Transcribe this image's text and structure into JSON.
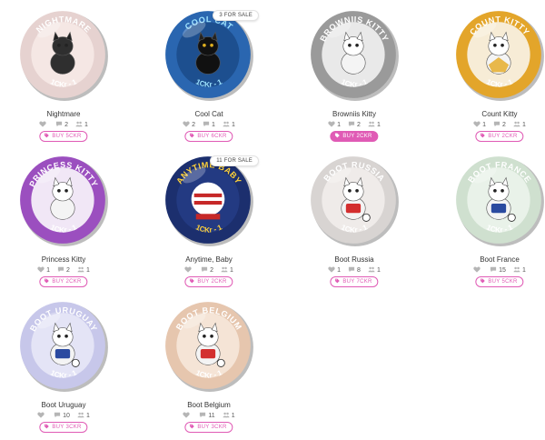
{
  "coins": [
    {
      "name": "Nightmare",
      "coin_title": "NIGHTMARE",
      "coin_sub": "1CKr - 1",
      "likes": "",
      "comments": "2",
      "owners": "1",
      "buy_label": "BUY 5CKR",
      "sale_badge": "",
      "buy_active": false,
      "rim": "#e6d2d0",
      "face": "#f5e7e4",
      "text_color": "#ffffff",
      "theme": "pink"
    },
    {
      "name": "Cool Cat",
      "coin_title": "COOL CAT",
      "coin_sub": "1CKr - 1",
      "likes": "2",
      "comments": "1",
      "owners": "1",
      "buy_label": "BUY 6CKR",
      "sale_badge": "3 FOR SALE",
      "buy_active": false,
      "rim": "#2a66b0",
      "face": "#1d4f8f",
      "text_color": "#9ee3ff",
      "theme": "blue"
    },
    {
      "name": "Browniis Kitty",
      "coin_title": "BROWNIIS KITTY",
      "coin_sub": "1CKr - 1",
      "likes": "1",
      "comments": "2",
      "owners": "1",
      "buy_label": "BUY 2CKR",
      "sale_badge": "",
      "buy_active": true,
      "rim": "#9a9a9a",
      "face": "#e9e9e9",
      "text_color": "#ffffff",
      "theme": "gray"
    },
    {
      "name": "Count Kitty",
      "coin_title": "COUNT KITTY",
      "coin_sub": "1CKr - 1",
      "likes": "1",
      "comments": "2",
      "owners": "1",
      "buy_label": "BUY 2CKR",
      "sale_badge": "",
      "buy_active": false,
      "rim": "#e3a52a",
      "face": "#f7ecd6",
      "text_color": "#ffffff",
      "theme": "gold"
    },
    {
      "name": "Princess Kitty",
      "coin_title": "PRINCESS KITTY",
      "coin_sub": "1CKr - 1",
      "likes": "1",
      "comments": "2",
      "owners": "1",
      "buy_label": "BUY 2CKR",
      "sale_badge": "",
      "buy_active": false,
      "rim": "#9b4fbf",
      "face": "#f1e7f6",
      "text_color": "#ffffff",
      "theme": "purple"
    },
    {
      "name": "Anytime, Baby",
      "coin_title": "ANYTIME BABY",
      "coin_sub": "1CKr - 1",
      "likes": "",
      "comments": "2",
      "owners": "1",
      "buy_label": "BUY 2CKR",
      "sale_badge": "11 FOR SALE",
      "buy_active": false,
      "rim": "#1c2f6e",
      "face": "#233a82",
      "text_color": "#ffd23a",
      "theme": "navy"
    },
    {
      "name": "Boot Russia",
      "coin_title": "BOOT RUSSIA",
      "coin_sub": "1CKr - 1",
      "likes": "1",
      "comments": "8",
      "owners": "1",
      "buy_label": "BUY 7CKR",
      "sale_badge": "",
      "buy_active": false,
      "rim": "#d8d4d2",
      "face": "#efebe9",
      "text_color": "#ffffff",
      "theme": "light"
    },
    {
      "name": "Boot France",
      "coin_title": "BOOT FRANCE",
      "coin_sub": "1CKr - 1",
      "likes": "",
      "comments": "15",
      "owners": "1",
      "buy_label": "BUY 5CKR",
      "sale_badge": "",
      "buy_active": false,
      "rim": "#cfe0cf",
      "face": "#e9f2e9",
      "text_color": "#ffffff",
      "theme": "green"
    },
    {
      "name": "Boot Uruguay",
      "coin_title": "BOOT URUGUAY",
      "coin_sub": "1CKr - 1",
      "likes": "",
      "comments": "10",
      "owners": "1",
      "buy_label": "BUY 3CKR",
      "sale_badge": "",
      "buy_active": false,
      "rim": "#c7c7ea",
      "face": "#e4e4f6",
      "text_color": "#ffffff",
      "theme": "lavender"
    },
    {
      "name": "Boot Belgium",
      "coin_title": "BOOT BELGIUM",
      "coin_sub": "1CKr - 1",
      "likes": "",
      "comments": "11",
      "owners": "1",
      "buy_label": "BUY 3CKR",
      "sale_badge": "",
      "buy_active": false,
      "rim": "#e6c6ae",
      "face": "#f5e4d6",
      "text_color": "#ffffff",
      "theme": "peach"
    }
  ],
  "accent_color": "#e05bb5"
}
